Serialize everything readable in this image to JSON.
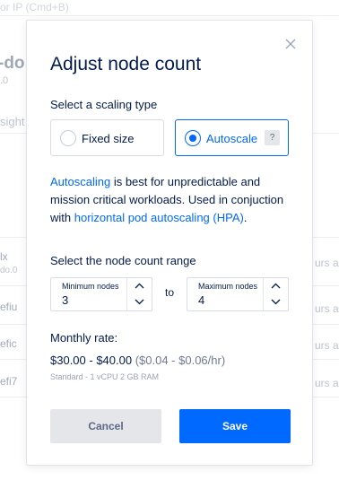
{
  "background": {
    "search_placeholder": "or IP (Cmd+B)",
    "cluster_title": "-do",
    "cluster_version": ".0",
    "insights_label": "sight",
    "rows": [
      {
        "name": "lx",
        "sub": "do.0",
        "age": "urs a"
      },
      {
        "name": "efiu",
        "sub": "",
        "age": "urs ag"
      },
      {
        "name": "efic",
        "sub": "",
        "age": "urs ag"
      },
      {
        "name": "efi7",
        "sub": "",
        "age": "urs ag"
      }
    ]
  },
  "modal": {
    "title": "Adjust node count",
    "close_icon": "close-icon",
    "scaling_label": "Select a scaling type",
    "scaling_options": [
      {
        "label": "Fixed size",
        "selected": false
      },
      {
        "label": "Autoscale",
        "selected": true,
        "help": "?"
      }
    ],
    "description": {
      "link1": "Autoscaling",
      "text1": " is best for unpredictable and mission critical workloads. Used in conjuction with ",
      "link2": "horizontal pod autoscaling (HPA)",
      "text2": "."
    },
    "range_label": "Select the node count range",
    "min": {
      "label": "Minimum nodes",
      "value": "3"
    },
    "to_text": "to",
    "max": {
      "label": "Maximum nodes",
      "value": "4"
    },
    "rate": {
      "label": "Monthly rate:",
      "main": "$30.00 - $40.00",
      "range": "($0.04 - $0.06/hr)",
      "spec": "Standard - 1 vCPU 2 GB RAM"
    },
    "cancel_label": "Cancel",
    "save_label": "Save",
    "colors": {
      "accent": "#0069ff",
      "text": "#031b4e",
      "muted": "#6d7a92"
    }
  }
}
